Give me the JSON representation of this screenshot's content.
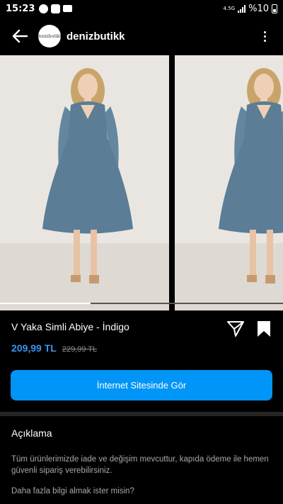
{
  "status_bar": {
    "time": "15:23",
    "network": "4.5G",
    "battery": "%10"
  },
  "header": {
    "avatar_text": "denizbutikk",
    "account_name": "denizbutikk"
  },
  "carousel": {
    "slide_count": 2,
    "progress_fraction": 0.32,
    "colors": {
      "background": "#e9e6e1",
      "dress": "#5b7d95"
    }
  },
  "product": {
    "name": "V Yaka Simli Abiye - İndigo",
    "price": "209,99 TL",
    "old_price": "229,99 TL"
  },
  "cta": {
    "label": "İnternet Sitesinde Gör"
  },
  "description": {
    "title": "Açıklama",
    "text": "Tüm ürünlerimizde iade ve değişim mevcuttur, kapıda ödeme ile hemen güvenli sipariş verebilirsiniz.",
    "question": "Daha fazla bilgi almak ister misin?"
  },
  "colors": {
    "accent": "#0095f6",
    "price": "#3897f0"
  }
}
